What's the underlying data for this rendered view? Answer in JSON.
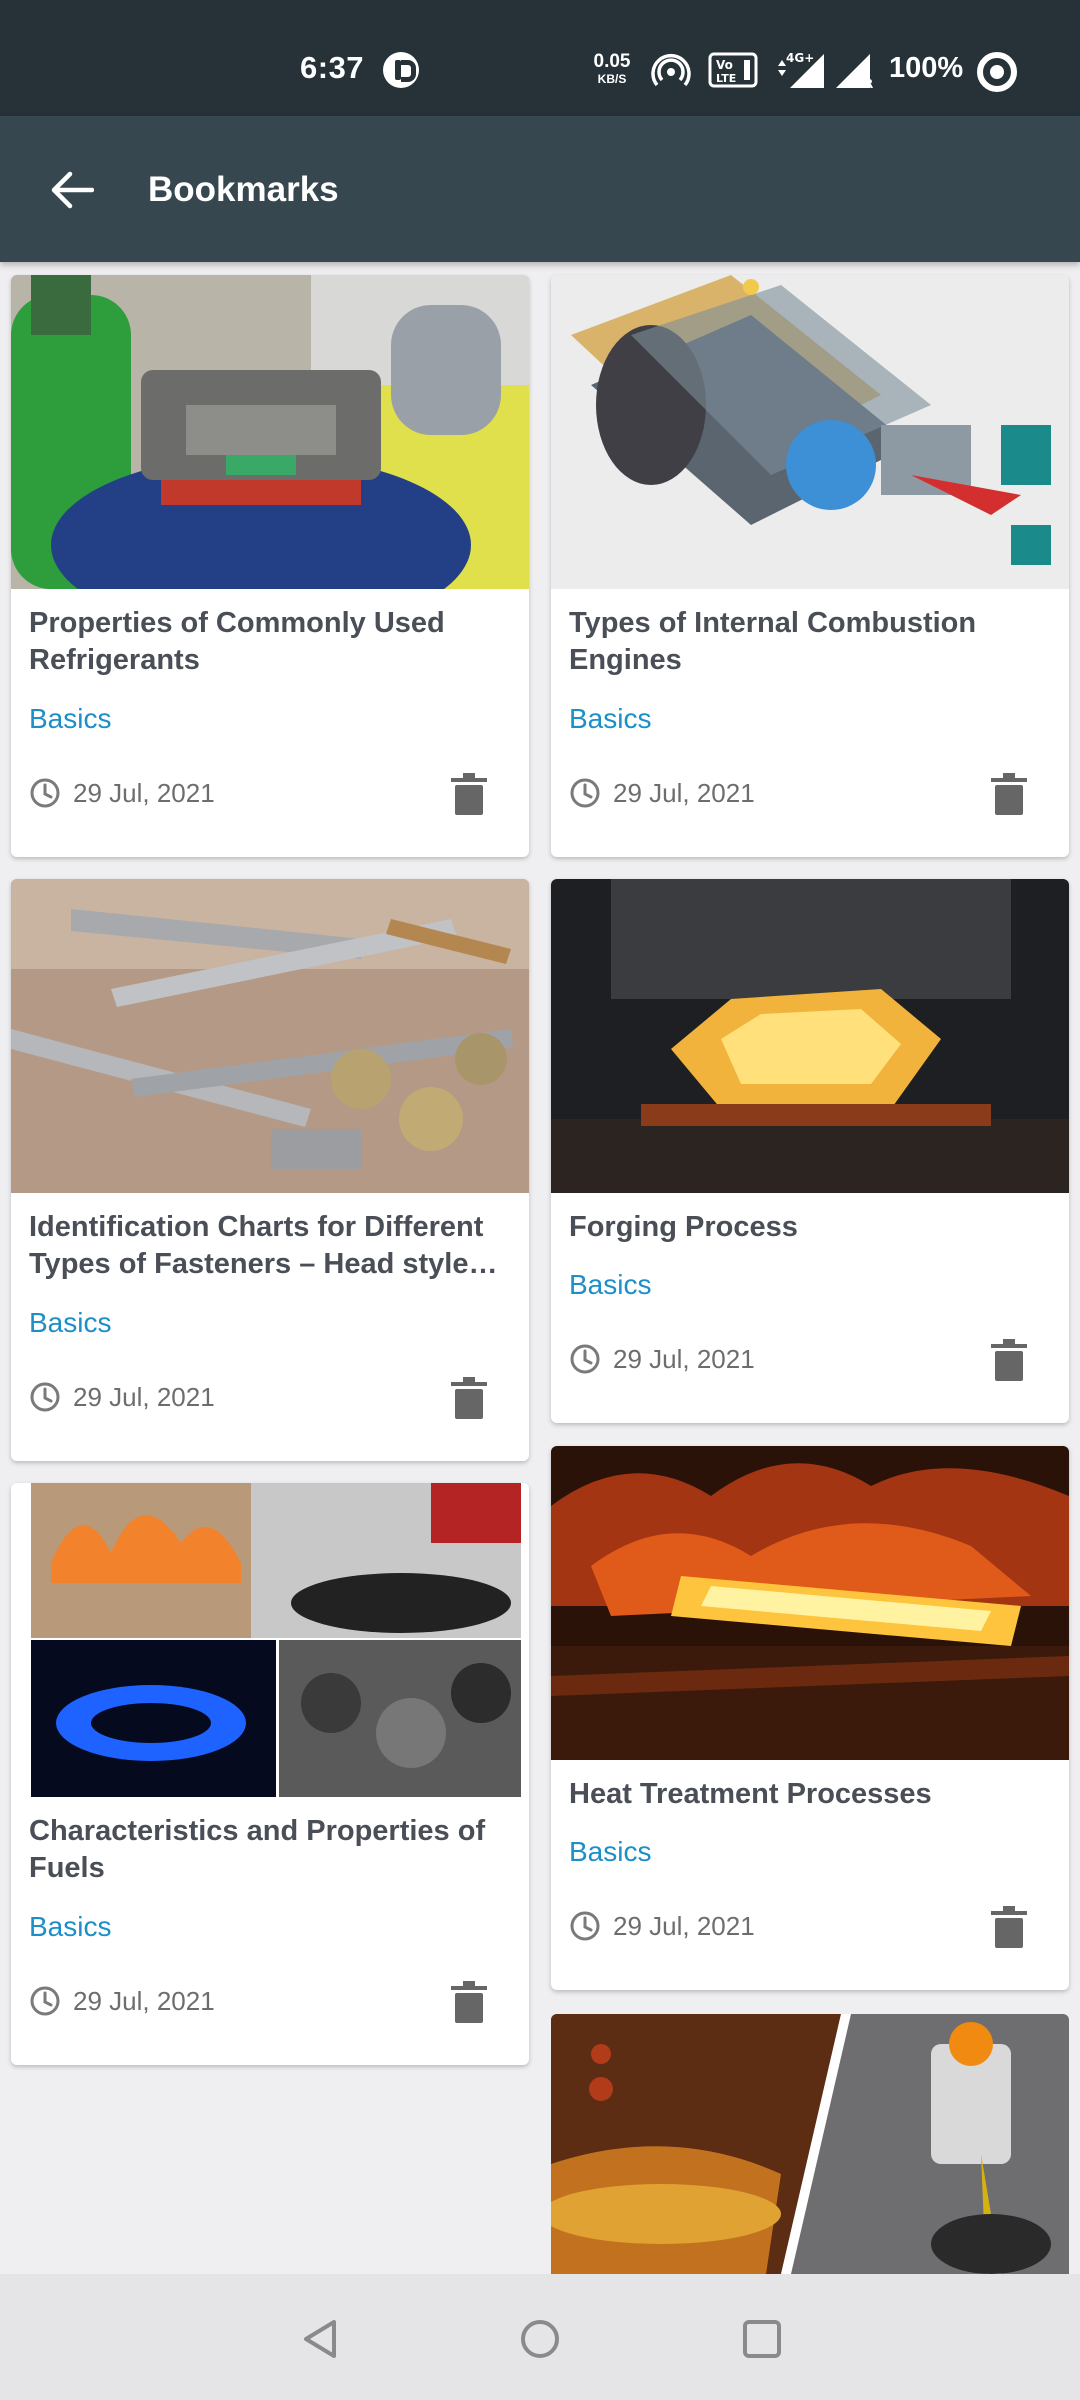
{
  "status_bar": {
    "time": "6:37",
    "net_speed_value": "0.05",
    "net_speed_unit": "KB/S",
    "network_label": "4G+",
    "battery": "100%"
  },
  "app_bar": {
    "title": "Bookmarks"
  },
  "cards": [
    {
      "title_lines": [
        "Properties of Commonly Used",
        "Refrigerants"
      ],
      "category": "Basics",
      "date": "29 Jul, 2021",
      "image": "refrigerant-cylinders-photo"
    },
    {
      "title_lines": [
        "Types of Internal Combustion",
        "Engines"
      ],
      "category": "Basics",
      "date": "29 Jul, 2021",
      "image": "engine-cutaway-illustration"
    },
    {
      "title_lines": [
        "Identification Charts for Different",
        "Types of Fasteners – Head style…"
      ],
      "category": "Basics",
      "date": "29 Jul, 2021",
      "image": "fasteners-photo"
    },
    {
      "title_lines": [
        "Forging Process"
      ],
      "category": "Basics",
      "date": "29 Jul, 2021",
      "image": "forging-photo"
    },
    {
      "title_lines": [
        "Characteristics and Properties of",
        "Fuels"
      ],
      "category": "Basics",
      "date": "29 Jul, 2021",
      "image": "fuels-collage-photo"
    },
    {
      "title_lines": [
        "Heat Treatment Processes"
      ],
      "category": "Basics",
      "date": "29 Jul, 2021",
      "image": "heat-treatment-photo"
    }
  ],
  "icons": {
    "back": "arrow-left-icon",
    "clock": "clock-icon",
    "delete": "trash-icon",
    "nav_back": "triangle-back-icon",
    "nav_home": "circle-home-icon",
    "nav_recents": "square-recents-icon"
  },
  "colors": {
    "status_bar_bg": "#263238",
    "app_bar_bg": "#37474f",
    "category_text": "#1c8fc8",
    "title_text": "#4a4f57",
    "page_bg": "#efeff1"
  }
}
